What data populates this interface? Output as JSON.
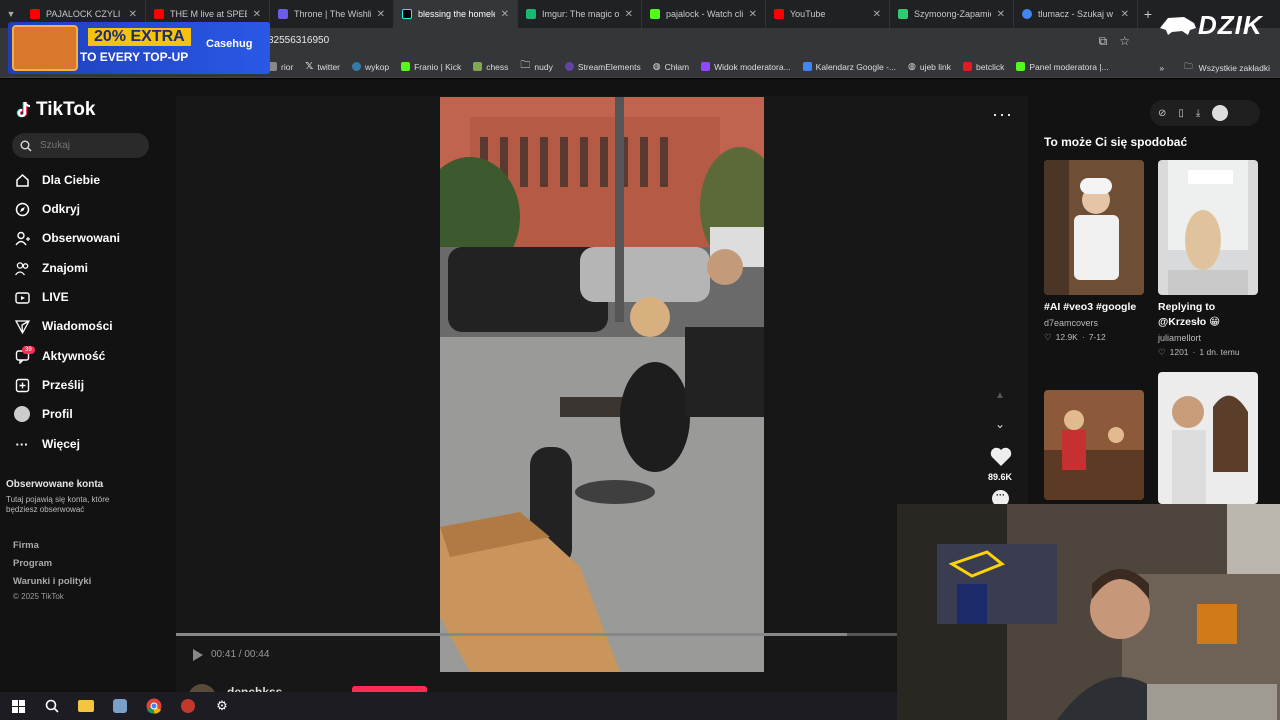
{
  "browser": {
    "tabs": [
      {
        "title": "PAJALOCK CZYLI PAT",
        "favicon_color": "#ff0000"
      },
      {
        "title": "THE M live at SPEEDI",
        "favicon_color": "#ff0000"
      },
      {
        "title": "Throne | The Wishlist",
        "favicon_color": "#6c5ce7"
      },
      {
        "title": "blessing the homeles",
        "favicon_color": "#000000"
      },
      {
        "title": "Imgur: The magic of",
        "favicon_color": "#1bb76e"
      },
      {
        "title": "pajalock - Watch clip",
        "favicon_color": "#53fc18"
      },
      {
        "title": "YouTube",
        "favicon_color": "#ff0000"
      },
      {
        "title": "Szymoong-Zapamiet",
        "favicon_color": "#2ecc71"
      },
      {
        "title": "tlumacz - Szukaj w G",
        "favicon_color": "#4285f4"
      }
    ],
    "active_tab_index": 3,
    "url": "82556316950",
    "bookmarks": [
      {
        "label": "rior",
        "color": "#888888"
      },
      {
        "label": "twitter",
        "color": "#000000"
      },
      {
        "label": "wykop",
        "color": "#367aa9"
      },
      {
        "label": "Franio | Kick",
        "color": "#53fc18"
      },
      {
        "label": "chess",
        "color": "#7fa650"
      },
      {
        "label": "nudy",
        "color": "#f4c542"
      },
      {
        "label": "StreamElements",
        "color": "#6441a5"
      },
      {
        "label": "Chłam",
        "color": "#aaaaaa"
      },
      {
        "label": "Widok moderatora...",
        "color": "#9146ff"
      },
      {
        "label": "Kalendarz Google -...",
        "color": "#4285f4"
      },
      {
        "label": "ujeb link",
        "color": "#dddddd"
      },
      {
        "label": "betclick",
        "color": "#e31b23"
      },
      {
        "label": "Panel moderatora |...",
        "color": "#53fc18"
      }
    ],
    "all_bookmarks_label": "Wszystkie zakładki"
  },
  "ad": {
    "line1": "20% EXTRA",
    "line2": "TO EVERY TOP-UP",
    "brand": "Casehug"
  },
  "overlay_logo": "DZIK",
  "tiktok": {
    "logo_text": "TikTok",
    "search_placeholder": "Szukaj",
    "nav": [
      {
        "label": "Dla Ciebie",
        "icon": "home-icon"
      },
      {
        "label": "Odkryj",
        "icon": "compass-icon"
      },
      {
        "label": "Obserwowani",
        "icon": "user-follow-icon"
      },
      {
        "label": "Znajomi",
        "icon": "friends-icon"
      },
      {
        "label": "LIVE",
        "icon": "live-icon"
      },
      {
        "label": "Wiadomości",
        "icon": "messages-icon"
      },
      {
        "label": "Aktywność",
        "icon": "activity-icon"
      },
      {
        "label": "Prześlij",
        "icon": "upload-icon"
      },
      {
        "label": "Profil",
        "icon": "profile-avatar"
      },
      {
        "label": "Więcej",
        "icon": "more-icon"
      }
    ],
    "activity_badge": "39",
    "followed_heading": "Obserwowane konta",
    "followed_sub": "Tutaj pojawią się konta, które będziesz obserwować",
    "footer_links": [
      "Firma",
      "Program",
      "Warunki i polityki"
    ],
    "copyright": "© 2025 TikTok",
    "video": {
      "likes": "89.6K",
      "time": "00:41 / 00:44",
      "progress": 0.93,
      "author": "denchkss"
    },
    "recommended_title": "To może Ci się spodobać",
    "recommended": [
      {
        "caption": "#AI #veo3 #google",
        "author": "d7eamcovers",
        "likes": "12.9K",
        "date": "7-12"
      },
      {
        "caption": "Replying to @Krzesło 😁",
        "author": "juliamellort",
        "likes": "1201",
        "date": "1 dn. temu"
      },
      {
        "caption": "",
        "author": "",
        "likes": "",
        "date": ""
      },
      {
        "caption": "",
        "author": "",
        "likes": "",
        "date": ""
      }
    ]
  }
}
